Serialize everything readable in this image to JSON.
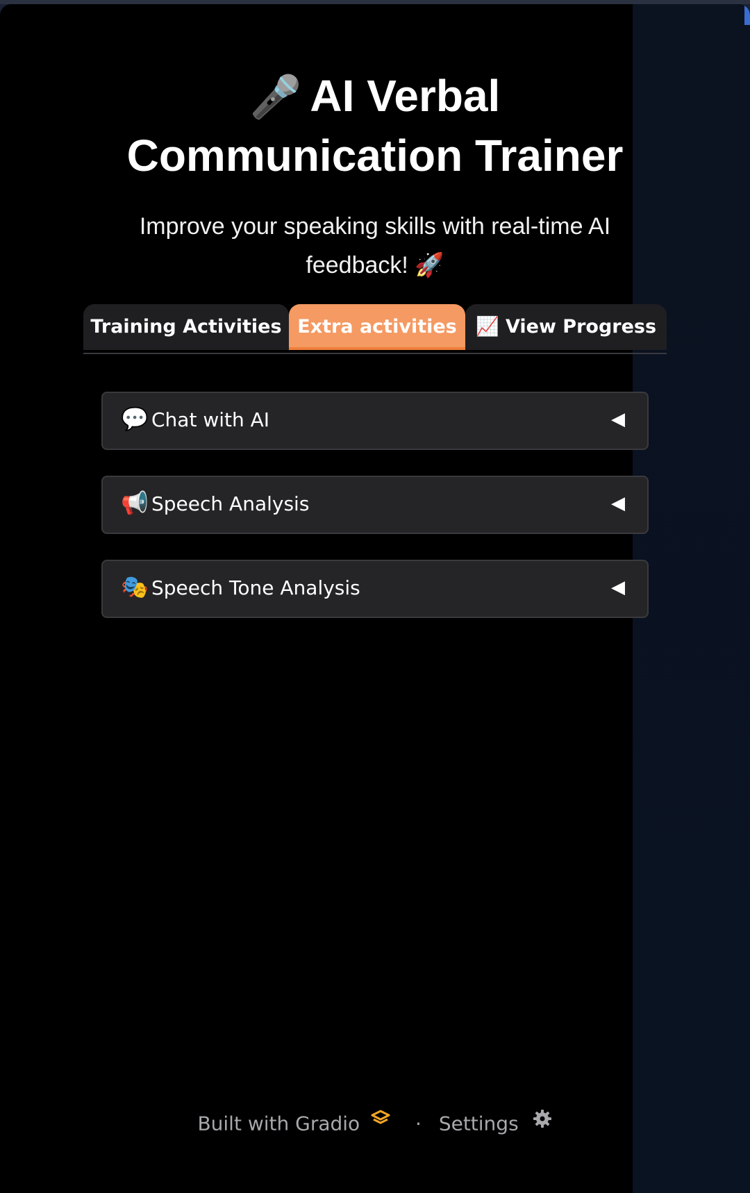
{
  "app": {
    "title_emoji": "🎤",
    "title": "AI Verbal Communication Trainer",
    "subtitle": "Improve your speaking skills with real-time AI feedback! 🚀"
  },
  "tabs": [
    {
      "label": "Training Activities",
      "active": false
    },
    {
      "label": "Extra activities",
      "active": true
    },
    {
      "label": "📈 View Progress",
      "active": false
    }
  ],
  "accordions": [
    {
      "emoji": "💬",
      "label": "Chat with AI",
      "caret": "◀"
    },
    {
      "emoji": "📢",
      "label": "Speech Analysis",
      "caret": "◀"
    },
    {
      "emoji": "🎭",
      "label": "Speech Tone Analysis",
      "caret": "◀"
    }
  ],
  "footer": {
    "built_with": "Built with Gradio",
    "separator": "·",
    "settings": "Settings"
  },
  "colors": {
    "accent": "#f49a62",
    "background": "#000000",
    "panel": "#252528"
  }
}
